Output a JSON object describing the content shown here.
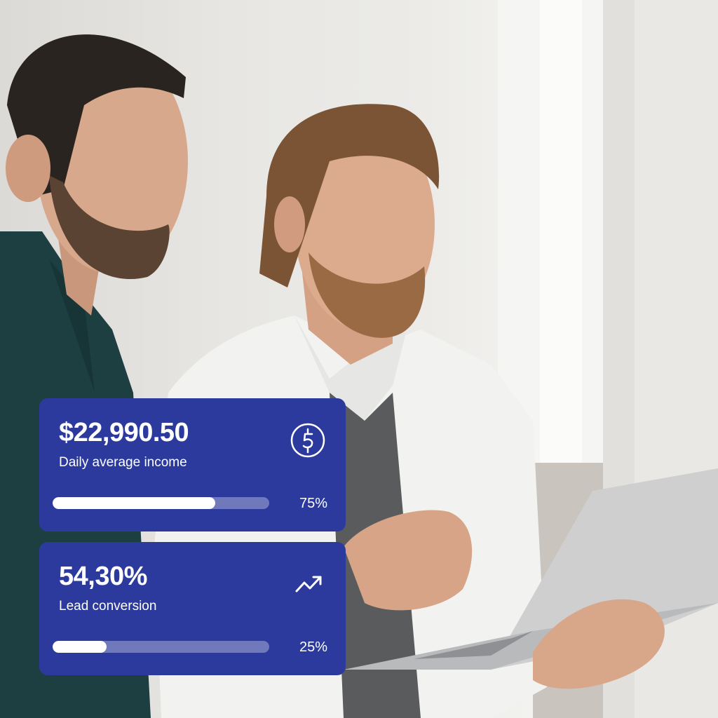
{
  "cards": {
    "income": {
      "value": "$22,990.50",
      "label": "Daily average income",
      "percent_text": "75%",
      "progress": 0.75,
      "icon": "dollar-coin-icon"
    },
    "lead": {
      "value": "54,30%",
      "label": "Lead conversion",
      "percent_text": "25%",
      "progress": 0.25,
      "icon": "trending-up-icon"
    }
  },
  "colors": {
    "card_background": "#2b3a9c",
    "progress_fill": "#ffffff",
    "text": "#ffffff"
  }
}
